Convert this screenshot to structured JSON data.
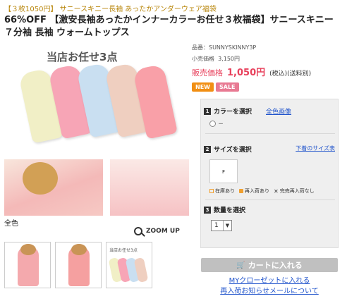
{
  "breadcrumb": "【３枚1050円】 サニースキニー長袖 あったかアンダーウェア福袋",
  "title": "66%OFF 【激安長袖あったかインナーカラーお任せ３枚福袋】サニースキニー ７分袖 長袖 ウォームトップス",
  "main_image": {
    "caption": "当店お任せ3点"
  },
  "all_color_label": "全色",
  "zoom": {
    "label": "ZOOM UP",
    "icon": "magnifier-icon"
  },
  "thumbs": {
    "third_caption": "当店お任せ3点"
  },
  "product": {
    "code_label": "品番：",
    "code": "SUNNYSKINNY3P",
    "list_price_label": "小売価格",
    "list_price": "3,150円",
    "sale_label": "販売価格",
    "sale_price": "1,050円",
    "tax_note": "(税込)(送料別)",
    "badges": [
      "NEW",
      "SALE"
    ]
  },
  "options": {
    "color": {
      "num": "1",
      "heading": "カラーを選択",
      "link": "全色画像",
      "value": "－"
    },
    "size": {
      "num": "2",
      "heading": "サイズを選択",
      "link": "下着のサイズ表",
      "value": "F"
    },
    "legend": {
      "in_stock": "在庫あり",
      "restock": "再入荷あり",
      "sold_out": "完売再入荷なし"
    },
    "quantity": {
      "num": "3",
      "heading": "数量を選択",
      "value": "1"
    }
  },
  "actions": {
    "cart": "カートに入れる",
    "closet": "MYクローゼットに入れる",
    "restock_notice": "再入荷お知らせメールについて"
  },
  "colors": {
    "accent_red": "#e8415c",
    "badge_new": "#f18f14",
    "badge_sale": "#e87a93",
    "link": "#2255cc",
    "breadcrumb": "#b8860b"
  }
}
